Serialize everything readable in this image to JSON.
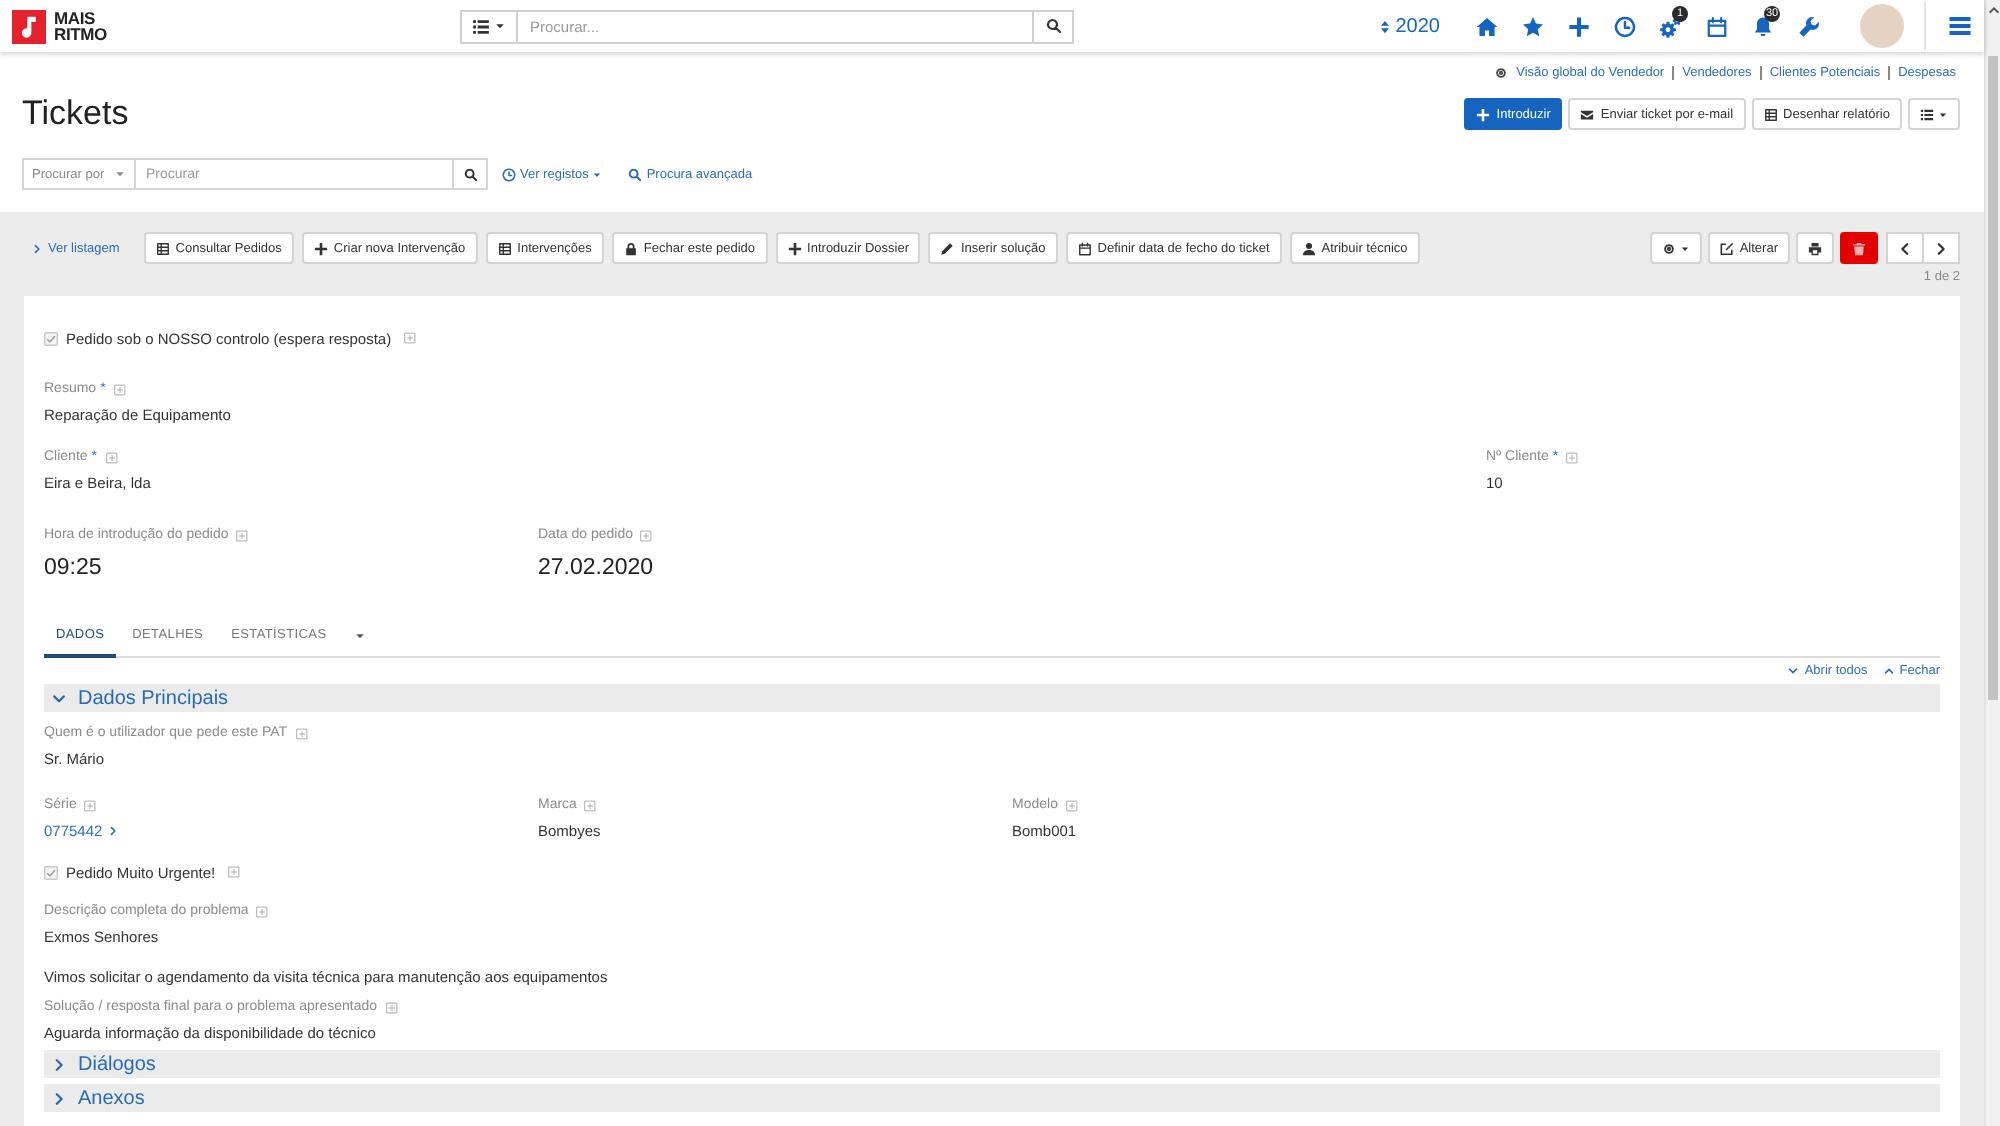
{
  "topbar": {
    "logo_text": "MAIS RITMO",
    "search": {
      "placeholder": "Procurar..."
    },
    "year": "2020",
    "gears_badge": "1",
    "bell_badge": "30"
  },
  "quick_links": [
    "Visão global do Vendedor",
    "Vendedores",
    "Clientes Potenciais",
    "Despesas"
  ],
  "page_title": "Tickets",
  "header_buttons": [
    {
      "label": "Introduzir",
      "kind": "primary"
    },
    {
      "label": "Enviar ticket por e-mail",
      "kind": "default"
    },
    {
      "label": "Desenhar relatório",
      "kind": "default"
    }
  ],
  "search": {
    "filter_placeholder": "Procurar por",
    "placeholder": "Procurar",
    "view_link": "Ver registos",
    "advanced_link": "Procura avançada"
  },
  "toolbar": {
    "back_link": "Ver listagem",
    "buttons": [
      "Consultar Pedidos",
      "Criar nova Intervenção",
      "Intervenções",
      "Fechar este pedido",
      "Introduzir Dossier",
      "Inserir solução",
      "Definir data de fecho do ticket",
      "Atribuir técnico"
    ],
    "edit_button": "Alterar",
    "pager": "1 de 2"
  },
  "record": {
    "control_checkbox": {
      "label": "Pedido sob o NOSSO controlo (espera resposta)",
      "checked": true
    },
    "summary": {
      "label": "Resumo",
      "required_mark": "*",
      "value": "Reparação de Equipamento"
    },
    "client": {
      "label": "Cliente",
      "required_mark": "*",
      "value": "Eira e Beira, lda"
    },
    "client_number": {
      "label": "Nº Cliente",
      "required_mark": "*",
      "value": "10"
    },
    "entry_time": {
      "label": "Hora de introdução do pedido",
      "value": "09:25"
    },
    "request_date": {
      "label": "Data do pedido",
      "value": "27.02.2020"
    },
    "tabs": [
      {
        "label": "DADOS",
        "selected": true
      },
      {
        "label": "DETALHES",
        "selected": false
      },
      {
        "label": "ESTATÍSTICAS",
        "selected": false
      }
    ],
    "expand_all": "Abrir todos",
    "collapse_all": "Fechar",
    "sections": [
      {
        "title": "Dados Principais",
        "expanded": true,
        "requester": {
          "label": "Quem é o utilizador que pede este PAT",
          "value": "Sr. Mário"
        },
        "serial": {
          "label": "Série",
          "value": "0775442"
        },
        "brand": {
          "label": "Marca",
          "value": "Bombyes"
        },
        "model": {
          "label": "Modelo",
          "value": "Bomb001"
        },
        "urgent_checkbox": {
          "label": "Pedido Muito Urgente!",
          "checked": true
        },
        "description": {
          "label": "Descrição completa do problema",
          "value": "Exmos Senhores\n\nVimos solicitar o agendamento da visita técnica para manutenção aos equipamentos"
        },
        "solution": {
          "label": "Solução / resposta final para o problema apresentado",
          "value": "Aguarda informação da disponibilidade do técnico"
        }
      },
      {
        "title": "Diálogos",
        "expanded": false
      },
      {
        "title": "Anexos",
        "expanded": false
      }
    ]
  }
}
